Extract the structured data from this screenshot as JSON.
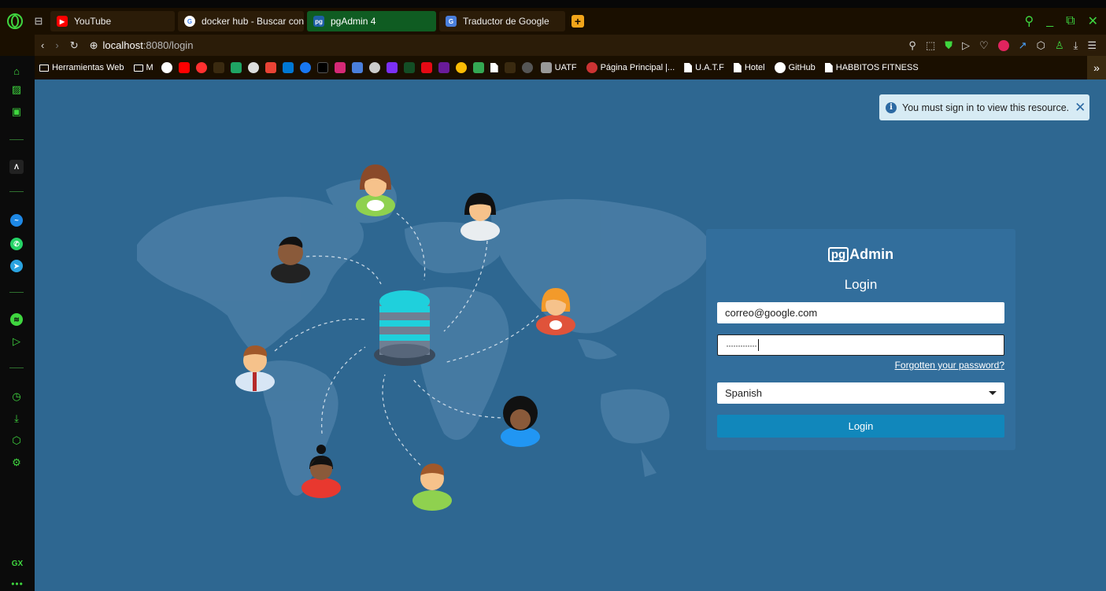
{
  "browser": {
    "tabs": [
      {
        "label": "YouTube",
        "icon": "youtube-favicon"
      },
      {
        "label": "docker hub - Buscar con",
        "icon": "google-favicon"
      },
      {
        "label": "pgAdmin 4",
        "icon": "pgadmin-favicon",
        "active": true
      },
      {
        "label": "Traductor de Google",
        "icon": "google-translate-favicon"
      }
    ],
    "url_host": "localhost",
    "url_path": ":8080/login",
    "bookmarks": {
      "folder1": "Herramientas Web",
      "folder2": "M",
      "uatf": "UATF",
      "pagina": "Página Principal |...",
      "uatf2": "U.A.T.F",
      "hotel": "Hotel",
      "github": "GitHub",
      "habbitos": "HABBITOS FITNESS"
    },
    "sidebar_bottom": "GX",
    "accent_color": "#3fd63f"
  },
  "page": {
    "toast": "You must sign in to view this resource.",
    "brand_pg": "pg",
    "brand_admin": "Admin",
    "login_title": "Login",
    "email_value": "correo@google.com",
    "password_mask": "·············",
    "forgot_link": "Forgotten your password?",
    "language_selected": "Spanish",
    "login_button": "Login",
    "background_color": "#2e6791",
    "button_color": "#1187bb"
  }
}
